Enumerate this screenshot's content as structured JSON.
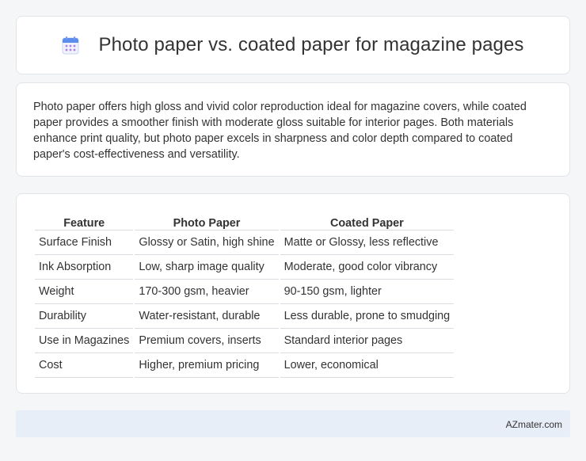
{
  "header": {
    "title": "Photo paper vs. coated paper for magazine pages",
    "icon": "calendar-icon"
  },
  "summary": {
    "text": "Photo paper offers high gloss and vivid color reproduction ideal for magazine covers, while coated paper provides a smoother finish with moderate gloss suitable for interior pages. Both materials enhance print quality, but photo paper excels in sharpness and color depth compared to coated paper's cost-effectiveness and versatility."
  },
  "table": {
    "headers": [
      "Feature",
      "Photo Paper",
      "Coated Paper"
    ],
    "rows": [
      [
        "Surface Finish",
        "Glossy or Satin, high shine",
        "Matte or Glossy, less reflective"
      ],
      [
        "Ink Absorption",
        "Low, sharp image quality",
        "Moderate, good color vibrancy"
      ],
      [
        "Weight",
        "170-300 gsm, heavier",
        "90-150 gsm, lighter"
      ],
      [
        "Durability",
        "Water-resistant, durable",
        "Less durable, prone to smudging"
      ],
      [
        "Use in Magazines",
        "Premium covers, inserts",
        "Standard interior pages"
      ],
      [
        "Cost",
        "Higher, premium pricing",
        "Lower, economical"
      ]
    ]
  },
  "footer": {
    "brand": "AZmater.com"
  },
  "colors": {
    "background": "#f5f6f8",
    "card": "#ffffff",
    "border": "#e1e4e8",
    "footer_bg": "#e8eef7",
    "icon_blue": "#5b8def",
    "icon_purple": "#b07fe6"
  }
}
